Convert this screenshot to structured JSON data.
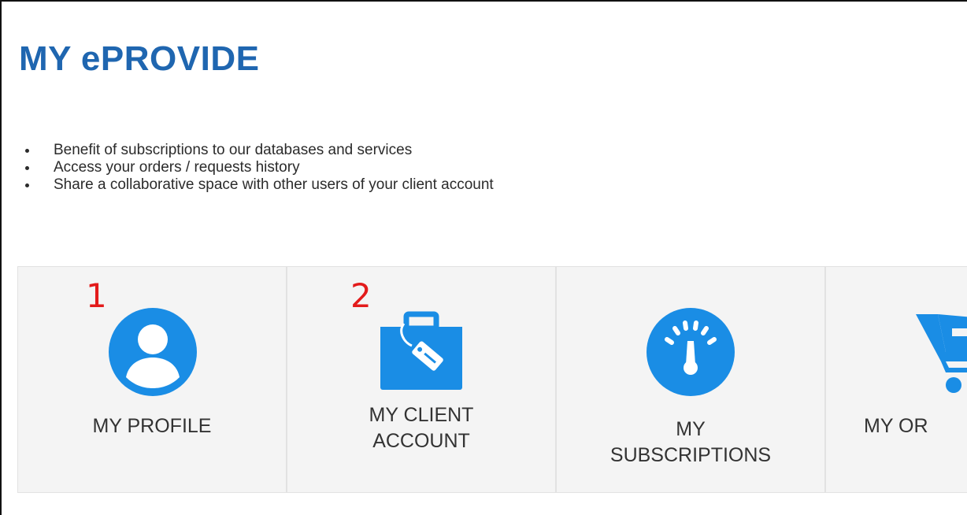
{
  "page": {
    "title": "MY ePROVIDE"
  },
  "bullets": [
    "Benefit of subscriptions to our databases and services",
    "Access your orders / requests history",
    "Share a collaborative space with other users of your client account"
  ],
  "tiles": [
    {
      "label": "MY PROFILE",
      "marker": "1",
      "icon": "user-icon"
    },
    {
      "label_line1": "MY CLIENT",
      "label_line2": "ACCOUNT",
      "marker": "2",
      "icon": "briefcase-tag-icon"
    },
    {
      "label_line1": "MY",
      "label_line2": "SUBSCRIPTIONS",
      "icon": "speedometer-icon"
    },
    {
      "label": "MY OR",
      "icon": "shopping-cart-icon"
    }
  ],
  "colors": {
    "title": "#1f66b0",
    "icon": "#1a8de5",
    "marker": "#e31b1b",
    "tile_bg": "#f4f4f4"
  }
}
